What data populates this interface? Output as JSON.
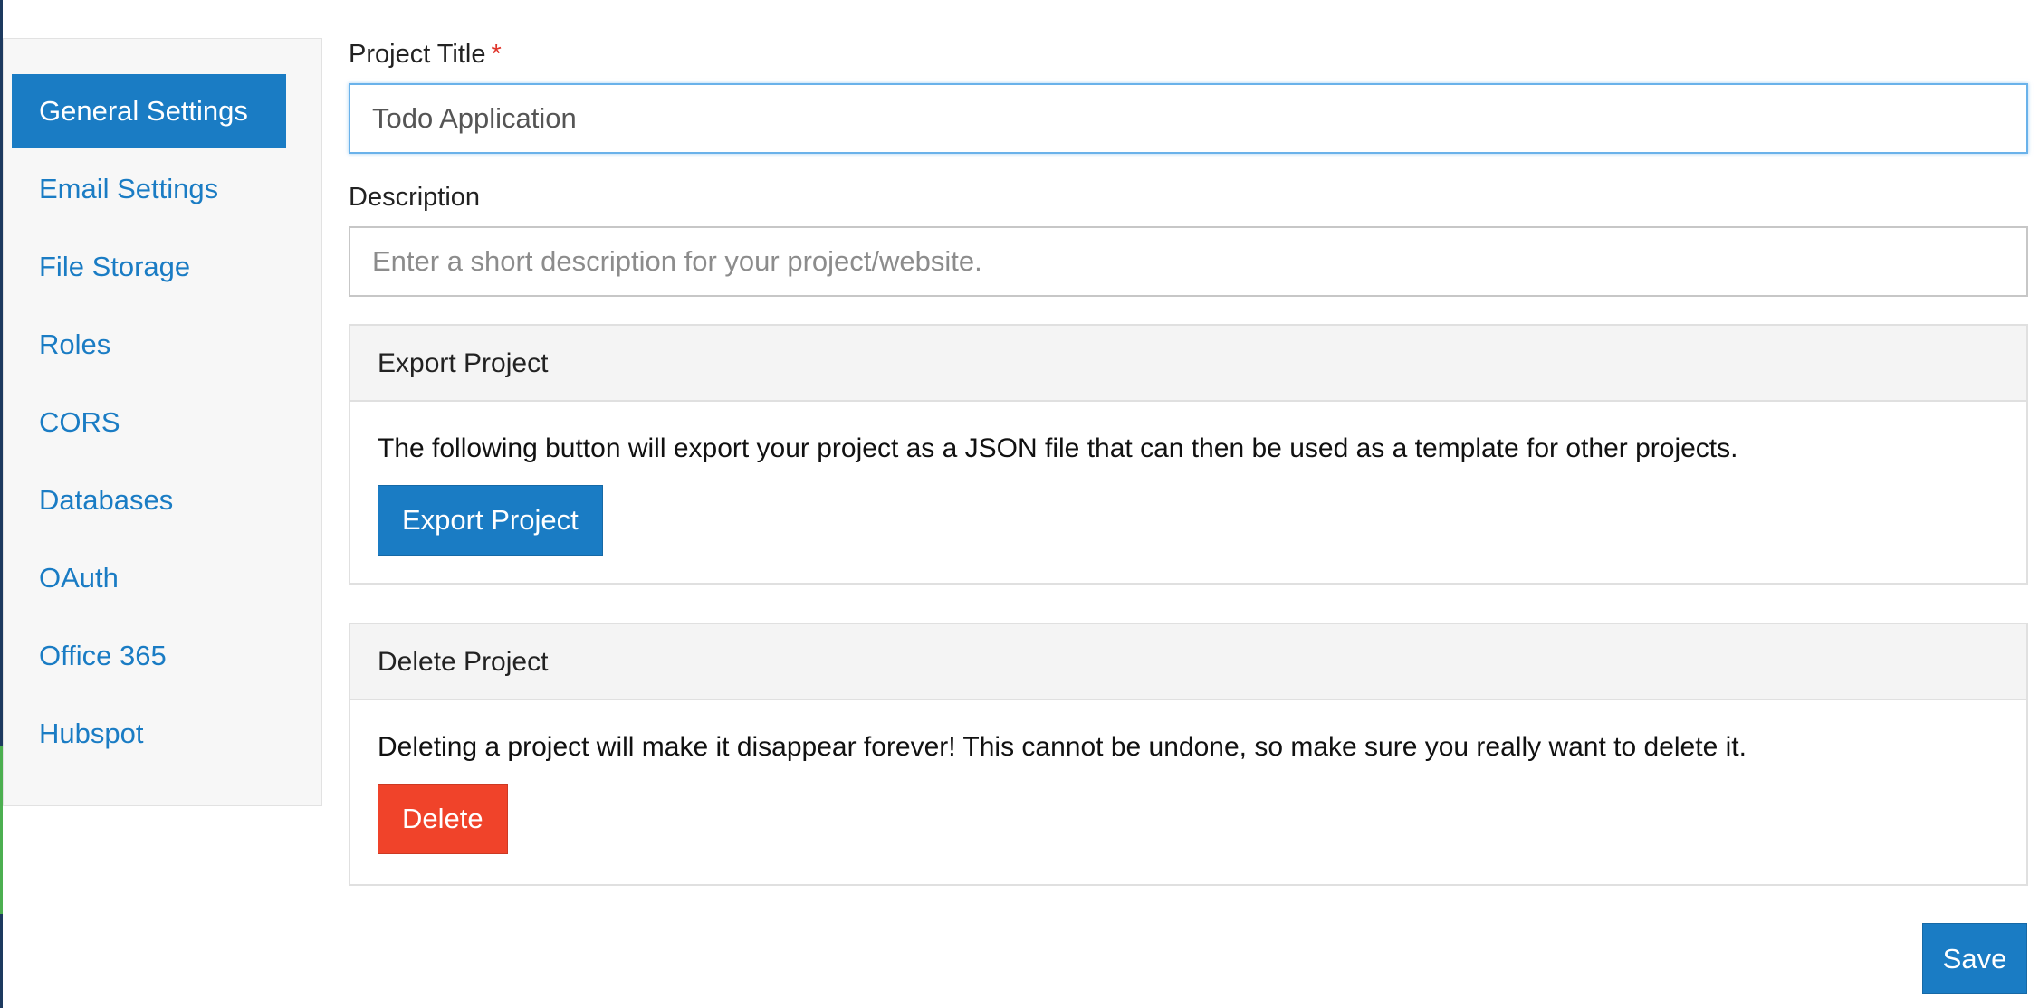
{
  "sidebar": {
    "items": [
      {
        "label": "General Settings",
        "active": true
      },
      {
        "label": "Email Settings"
      },
      {
        "label": "File Storage"
      },
      {
        "label": "Roles"
      },
      {
        "label": "CORS"
      },
      {
        "label": "Databases"
      },
      {
        "label": "OAuth"
      },
      {
        "label": "Office 365"
      },
      {
        "label": "Hubspot"
      }
    ]
  },
  "form": {
    "title_label": "Project Title",
    "required_mark": "*",
    "title_value": "Todo Application",
    "description_label": "Description",
    "description_value": "",
    "description_placeholder": "Enter a short description for your project/website."
  },
  "export_panel": {
    "heading": "Export Project",
    "text": "The following button will export your project as a JSON file that can then be used as a template for other projects.",
    "button_label": "Export Project"
  },
  "delete_panel": {
    "heading": "Delete Project",
    "text": "Deleting a project will make it disappear forever! This cannot be undone, so make sure you really want to delete it.",
    "button_label": "Delete"
  },
  "save_label": "Save",
  "colors": {
    "accent": "#1a7cc4",
    "danger": "#f0432a",
    "required": "#e0342a"
  }
}
